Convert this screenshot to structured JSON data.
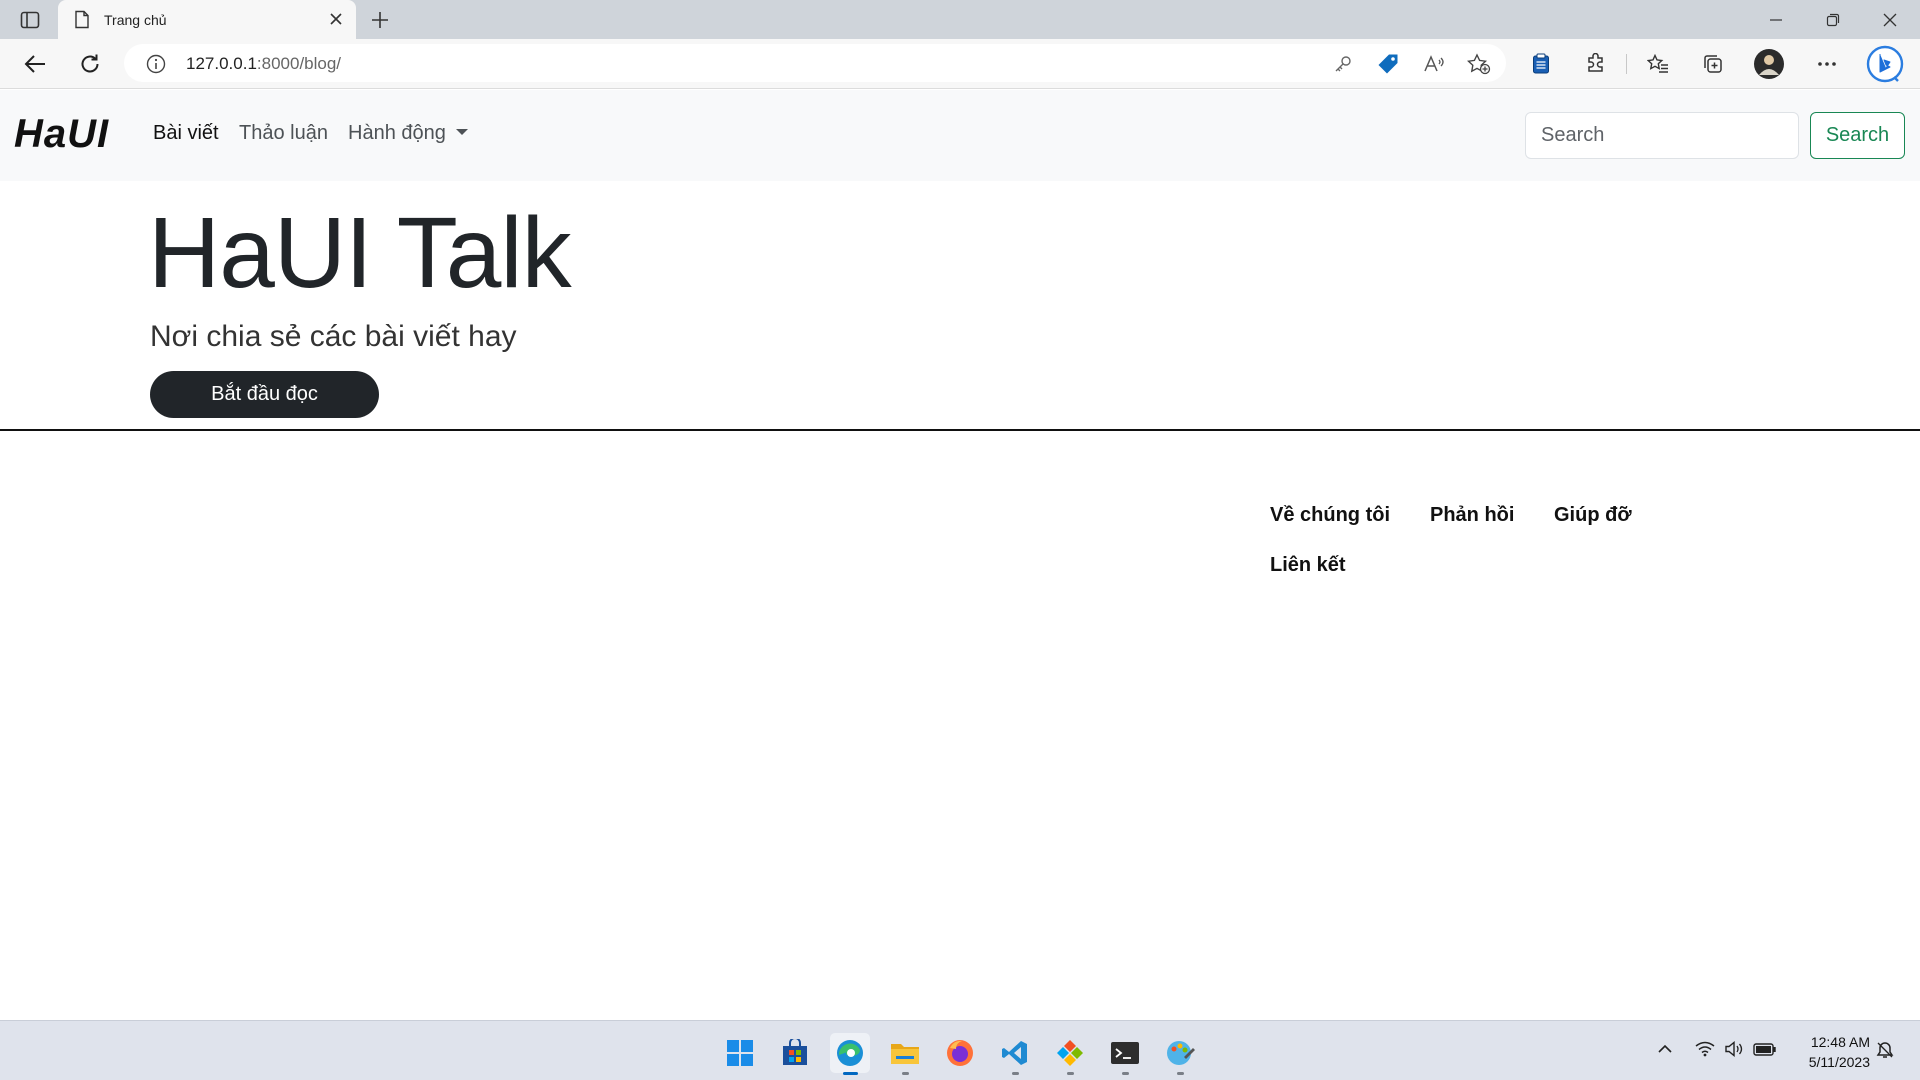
{
  "browser": {
    "tab_title": "Trang chủ",
    "url_host": "127.0.0.1",
    "url_rest": ":8000/blog/"
  },
  "navbar": {
    "brand": "HaUI",
    "links": [
      "Bài viết",
      "Thảo luận",
      "Hành động"
    ],
    "search_placeholder": "Search",
    "search_button": "Search"
  },
  "hero": {
    "title": "HaUI Talk",
    "subtitle": "Nơi chia sẻ các bài viết hay",
    "button": "Bắt đầu đọc"
  },
  "footer": {
    "links": [
      "Về chúng tôi",
      "Phản hồi",
      "Giúp đỡ",
      "Liên kết"
    ]
  },
  "taskbar": {
    "time": "12:48 AM",
    "date": "5/11/2023"
  },
  "colors": {
    "success": "#198754",
    "dark": "#212529",
    "navbar_bg": "#f8f9fa"
  }
}
